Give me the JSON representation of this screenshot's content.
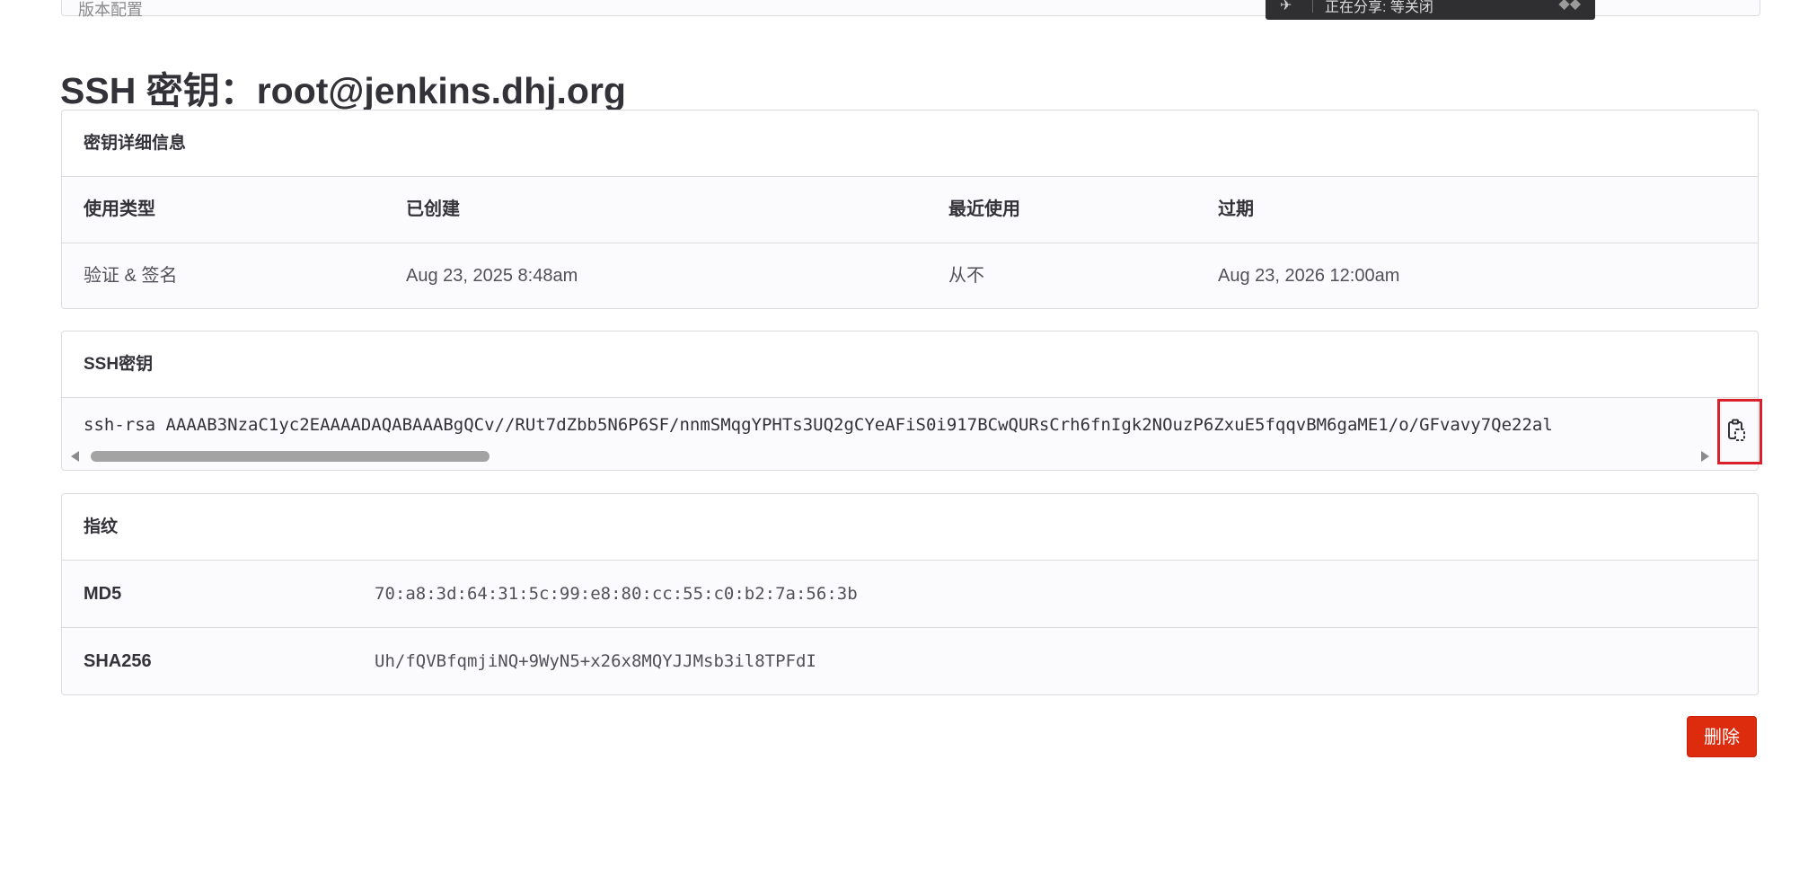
{
  "page": {
    "title": "SSH 密钥：root@jenkins.dhj.org"
  },
  "top_strip": {
    "partial_text": "版本配置"
  },
  "tooltip": {
    "text": "正在分享: 等关闭"
  },
  "details": {
    "header": "密钥详细信息",
    "columns": [
      "使用类型",
      "已创建",
      "最近使用",
      "过期"
    ],
    "values": [
      "验证 & 签名",
      "Aug 23, 2025 8:48am",
      "从不",
      "Aug 23, 2026 12:00am"
    ]
  },
  "ssh_key": {
    "header": "SSH密钥",
    "value": "ssh-rsa AAAAB3NzaC1yc2EAAAADAQABAAABgQCv//RUt7dZbb5N6P6SF/nnmSMqgYPHTs3UQ2gCYeAFiS0i917BCwQURsCrh6fnIgk2NOuzP6ZxuE5fqqvBM6gaME1/o/GFvavy7Qe22al",
    "copy_icon": "clipboard-copy-icon"
  },
  "fingerprints": {
    "header": "指纹",
    "rows": [
      {
        "label": "MD5",
        "value": "70:a8:3d:64:31:5c:99:e8:80:cc:55:c0:b2:7a:56:3b"
      },
      {
        "label": "SHA256",
        "value": "Uh/fQVBfqmjiNQ+9WyN5+x26x8MQYJJMsb3il8TPFdI"
      }
    ]
  },
  "actions": {
    "delete_label": "删除"
  },
  "colors": {
    "danger": "#dd2b0e",
    "highlight": "#d9202b",
    "border": "#dcdcde",
    "row_bg": "#fbfafd"
  }
}
